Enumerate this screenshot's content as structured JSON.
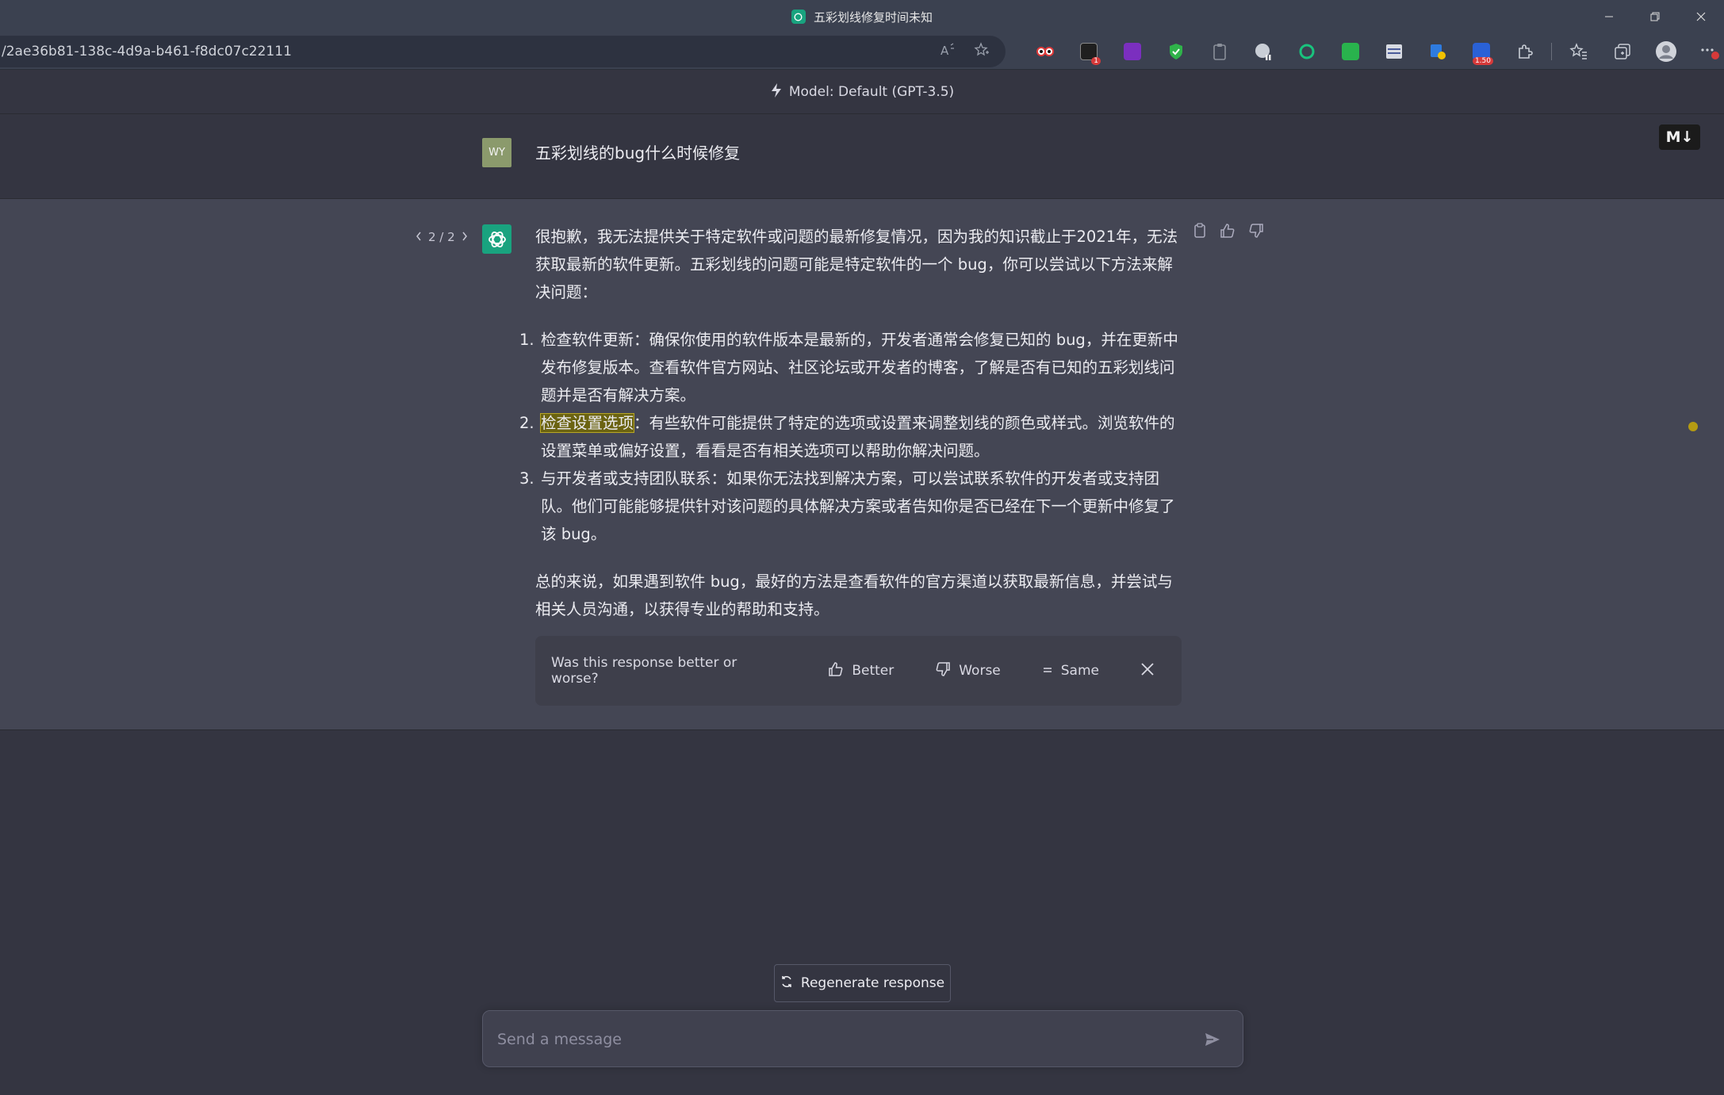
{
  "browser": {
    "tab_title": "五彩划线修复时间未知",
    "url": "/2ae36b81-138c-4d9a-b461-f8dc07c22111",
    "extensions": [
      {
        "name": "eyes-extension-icon",
        "color": "#e23a3a"
      },
      {
        "name": "monster-extension-icon",
        "color": "#1f1f1f",
        "badge": "1"
      },
      {
        "name": "reader-extension-icon",
        "color": "#7b2fbf"
      },
      {
        "name": "shield-extension-icon",
        "color": "#2fb34a"
      },
      {
        "name": "clipboard-extension-icon",
        "color": "#8a8f99"
      },
      {
        "name": "globe-paused-extension-icon",
        "color": "#c9ced6"
      },
      {
        "name": "openai-extension-icon",
        "color": "#19c37d"
      },
      {
        "name": "pen-extension-icon",
        "color": "#29b34d"
      },
      {
        "name": "window-extension-icon",
        "color": "#d8dbe3"
      },
      {
        "name": "map-pin-extension-icon",
        "color": "#2e7be0"
      },
      {
        "name": "video-speed-extension-icon",
        "color": "#2a61d6",
        "badge": "1.50"
      }
    ]
  },
  "model_bar": {
    "label": "Model: Default (GPT-3.5)"
  },
  "user_message": {
    "avatar_initials": "WY",
    "text": "五彩划线的bug什么时候修复"
  },
  "markdown_badge": "M↓",
  "assistant_message": {
    "pager": {
      "current_total": "2 / 2"
    },
    "intro": "很抱歉，我无法提供关于特定软件或问题的最新修复情况，因为我的知识截止于2021年，无法获取最新的软件更新。五彩划线的问题可能是特定软件的一个 bug，你可以尝试以下方法来解决问题：",
    "steps": [
      {
        "num": "1.",
        "highlight": "",
        "text": "检查软件更新：确保你使用的软件版本是最新的，开发者通常会修复已知的 bug，并在更新中发布修复版本。查看软件官方网站、社区论坛或开发者的博客，了解是否有已知的五彩划线问题并是否有解决方案。"
      },
      {
        "num": "2.",
        "highlight": "检查设置选项",
        "text": "：有些软件可能提供了特定的选项或设置来调整划线的颜色或样式。浏览软件的设置菜单或偏好设置，看看是否有相关选项可以帮助你解决问题。"
      },
      {
        "num": "3.",
        "highlight": "",
        "text": "与开发者或支持团队联系：如果你无法找到解决方案，可以尝试联系软件的开发者或支持团队。他们可能能够提供针对该问题的具体解决方案或者告知你是否已经在下一个更新中修复了该 bug。"
      }
    ],
    "conclusion": "总的来说，如果遇到软件 bug，最好的方法是查看软件的官方渠道以获取最新信息，并尝试与相关人员沟通，以获得专业的帮助和支持。"
  },
  "feedback": {
    "question": "Was this response better or worse?",
    "better": "Better",
    "worse": "Worse",
    "same": "Same"
  },
  "regenerate": {
    "label": "Regenerate response"
  },
  "composer": {
    "placeholder": "Send a message",
    "value": ""
  },
  "colors": {
    "accent": "#19a37f",
    "highlight": "#6b6311",
    "background": "#343541",
    "assistant_bg": "#444654"
  }
}
